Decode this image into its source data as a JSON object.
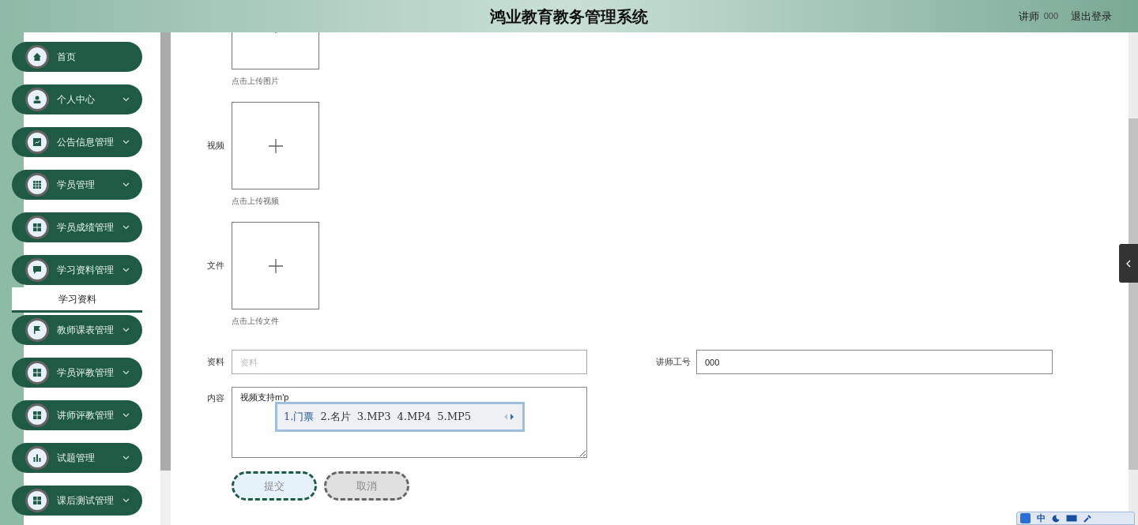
{
  "header": {
    "title": "鸿业教育教务管理系统",
    "role": "讲师",
    "user": "000",
    "logout": "退出登录"
  },
  "sidebar": {
    "items": [
      {
        "label": "首页",
        "kind": "link"
      },
      {
        "label": "个人中心",
        "kind": "menu"
      },
      {
        "label": "公告信息管理",
        "kind": "menu"
      },
      {
        "label": "学员管理",
        "kind": "menu"
      },
      {
        "label": "学员成绩管理",
        "kind": "menu"
      },
      {
        "label": "学习资料管理",
        "kind": "menu",
        "children": [
          {
            "label": "学习资料",
            "selected": true
          }
        ]
      },
      {
        "label": "教师课表管理",
        "kind": "menu"
      },
      {
        "label": "学员评教管理",
        "kind": "menu"
      },
      {
        "label": "讲师评教管理",
        "kind": "menu"
      },
      {
        "label": "试题管理",
        "kind": "menu"
      },
      {
        "label": "课后测试管理",
        "kind": "menu"
      }
    ]
  },
  "form": {
    "uploads": [
      {
        "hint": "点击上传图片"
      },
      {
        "label": "视频",
        "hint": "点击上传视频"
      },
      {
        "label": "文件",
        "hint": "点击上传文件"
      }
    ],
    "material": {
      "label": "资料",
      "placeholder": "资料"
    },
    "teacher_id": {
      "label": "讲师工号",
      "value": "000"
    },
    "content": {
      "label": "内容",
      "value": "视频支持m'p"
    },
    "buttons": [
      {
        "label": "提交",
        "kind": "primary"
      },
      {
        "label": "取消",
        "kind": "secondary"
      }
    ]
  },
  "ime": {
    "candidates": [
      {
        "text": "1.门票",
        "selected": true
      },
      {
        "text": "2.名片",
        "selected": false
      },
      {
        "text": "3.MP3",
        "selected": false
      },
      {
        "text": "4.MP4",
        "selected": false
      },
      {
        "text": "5.MP5",
        "selected": false
      }
    ],
    "status": "中"
  }
}
